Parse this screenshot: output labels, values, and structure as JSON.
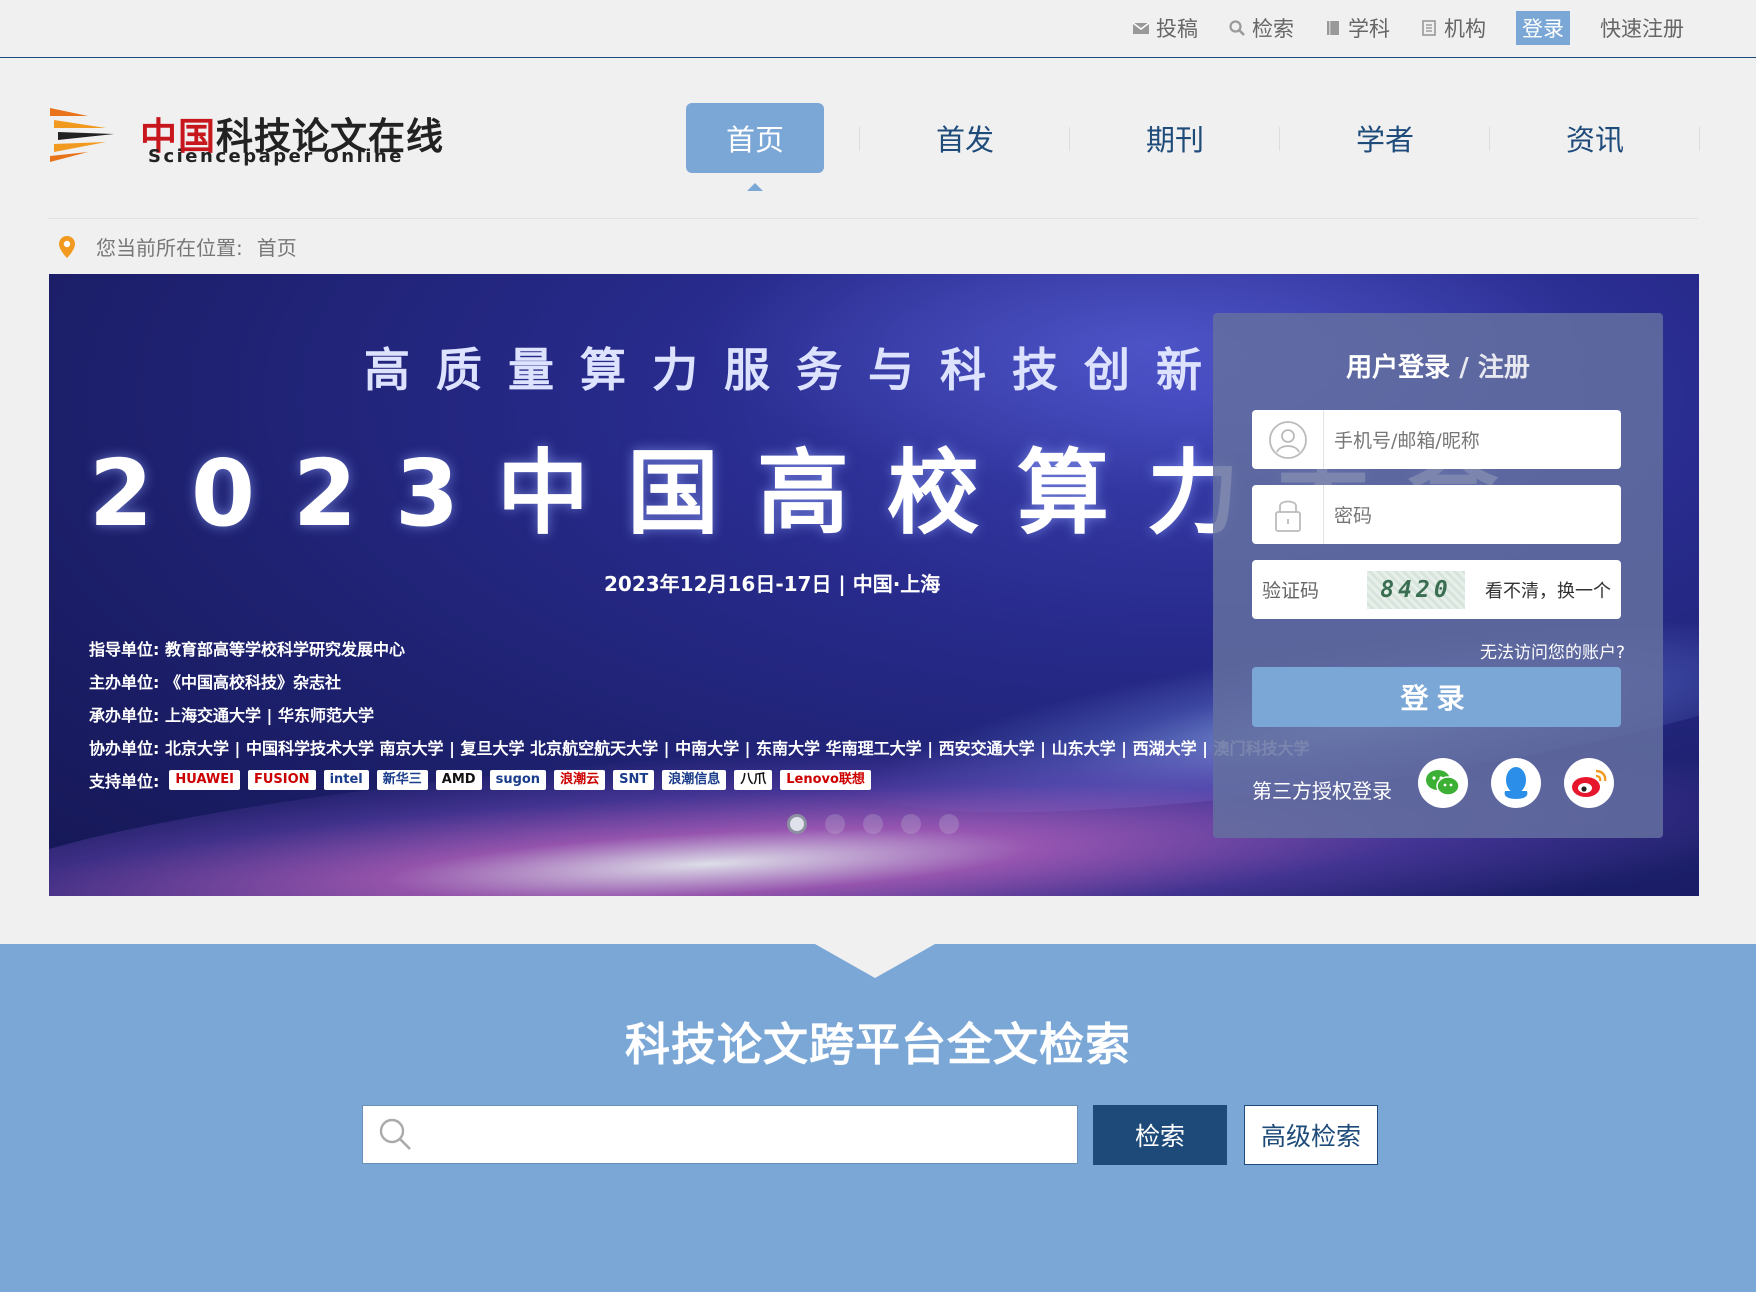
{
  "topnav": {
    "items": [
      {
        "label": "投稿",
        "icon": "mail-icon"
      },
      {
        "label": "检索",
        "icon": "search-icon"
      },
      {
        "label": "学科",
        "icon": "book-icon"
      },
      {
        "label": "机构",
        "icon": "building-icon"
      }
    ],
    "login": "登录",
    "register": "快速注册"
  },
  "logo": {
    "cn_red": "中国",
    "cn_black": "科技论文在线",
    "en": "Sciencepaper Online"
  },
  "mainnav": {
    "items": [
      {
        "label": "首页",
        "active": true
      },
      {
        "label": "首发"
      },
      {
        "label": "期刊"
      },
      {
        "label": "学者"
      },
      {
        "label": "资讯"
      }
    ]
  },
  "breadcrumb": {
    "prefix": "您当前所在位置:",
    "current": "首页"
  },
  "banner": {
    "subtitle": "高质量算力服务与科技创新",
    "title": "2023中国高校算力大会",
    "date": "2023年12月16日-17日 | 中国·上海",
    "org_lines": [
      "指导单位: 教育部高等学校科学研究发展中心",
      "主办单位: 《中国高校科技》杂志社",
      "承办单位: 上海交通大学 | 华东师范大学",
      "协办单位: 北京大学 | 中国科学技术大学  南京大学 | 复旦大学  北京航空航天大学 | 中南大学 | 东南大学  华南理工大学 | 西安交通大学 | 山东大学 | 西湖大学 | 澳门科技大学"
    ],
    "sponsors_label": "支持单位:",
    "sponsors": [
      "HUAWEI",
      "FUSION",
      "intel",
      "新华三",
      "AMD",
      "sugon",
      "浪潮云",
      "SNT",
      "浪潮信息",
      "八爪",
      "Lenovo联想"
    ],
    "slides": 5,
    "active_slide": 1
  },
  "login": {
    "title_login": "用户登录",
    "title_sep": "/",
    "title_register": "注册",
    "username_placeholder": "手机号/邮箱/昵称",
    "password_placeholder": "密码",
    "captcha_label": "验证码",
    "captcha_code": "8420",
    "captcha_swap": "看不清，换一个",
    "forgot": "无法访问您的账户?",
    "submit": "登录",
    "third_party": "第三方授权登录",
    "social": [
      {
        "icon": "wechat-icon",
        "color": "#3cb034"
      },
      {
        "icon": "qq-icon",
        "color": "#2b8ee8"
      },
      {
        "icon": "weibo-icon",
        "color": "#e6162d"
      }
    ]
  },
  "search": {
    "title": "科技论文跨平台全文检索",
    "value": "",
    "button": "检索",
    "advanced": "高级检索"
  }
}
